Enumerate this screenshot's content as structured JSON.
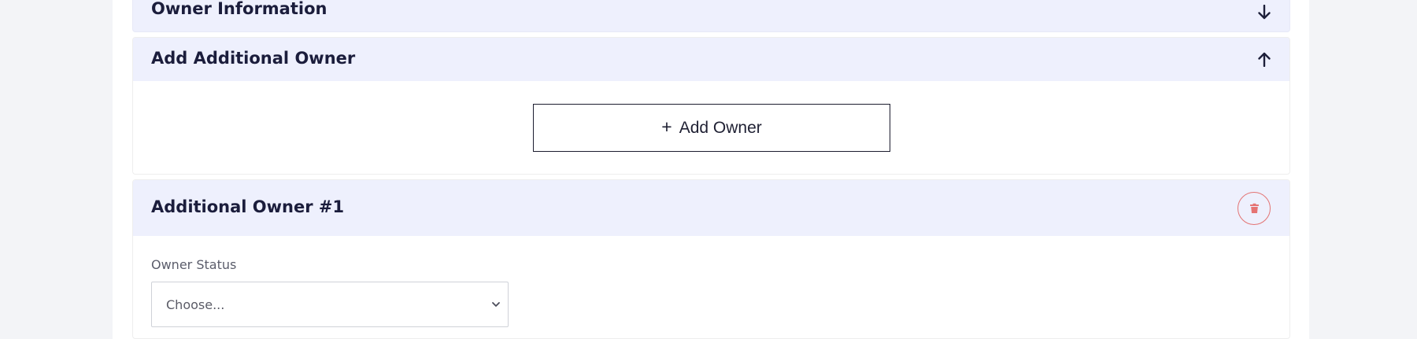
{
  "owner_information": {
    "title": "Owner Information",
    "toggle_icon": "arrow-down-icon"
  },
  "add_additional_owner": {
    "title": "Add Additional Owner",
    "toggle_icon": "arrow-up-icon",
    "button": {
      "icon": "plus-icon",
      "label": "Add Owner"
    }
  },
  "additional_owner": {
    "title": "Additional Owner #1",
    "delete_icon": "trash-icon",
    "colors": {
      "delete_accent": "#e57373",
      "header_background": "#eef0fd"
    },
    "owner_status": {
      "label": "Owner Status",
      "selected": "Choose...",
      "dropdown_icon": "chevron-down-icon"
    }
  }
}
